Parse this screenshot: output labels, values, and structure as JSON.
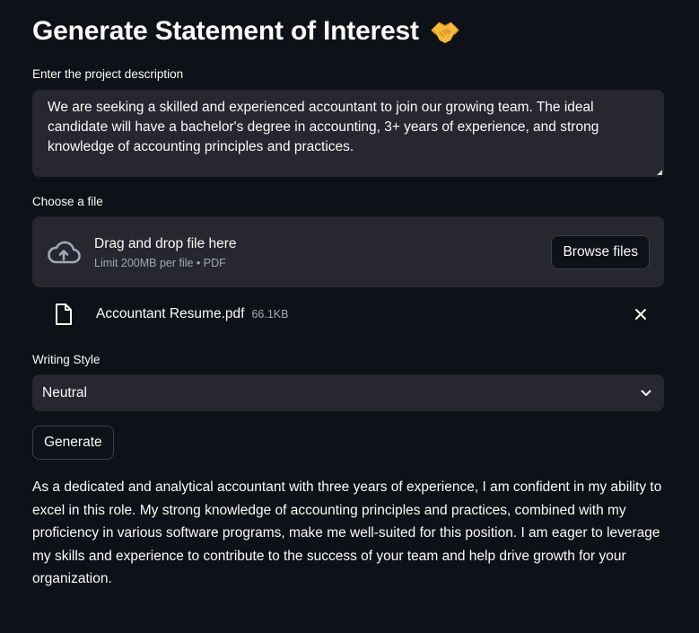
{
  "header": {
    "title": "Generate Statement of Interest",
    "emoji_icon": "handshake-icon"
  },
  "description": {
    "label": "Enter the project description",
    "value": "We are seeking a skilled and experienced accountant to join our growing team. The ideal candidate will have a bachelor's degree in accounting, 3+ years of experience, and strong knowledge of accounting principles and practices."
  },
  "uploader": {
    "label": "Choose a file",
    "drop_text": "Drag and drop file here",
    "limit_text": "Limit 200MB per file • PDF",
    "browse_label": "Browse files",
    "file": {
      "name": "Accountant Resume.pdf",
      "size": "66.1KB"
    }
  },
  "style": {
    "label": "Writing Style",
    "selected": "Neutral"
  },
  "generate_label": "Generate",
  "output_text": "As a dedicated and analytical accountant with three years of experience, I am confident in my ability to excel in this role. My strong knowledge of accounting principles and practices, combined with my proficiency in various software programs, make me well-suited for this position. I am eager to leverage my skills and experience to contribute to the success of your team and help drive growth for your organization.",
  "colors": {
    "background": "#0e1117",
    "surface": "#262730",
    "text": "#fafafa",
    "muted": "#a3a8b8",
    "emoji": "#f5b93b"
  }
}
